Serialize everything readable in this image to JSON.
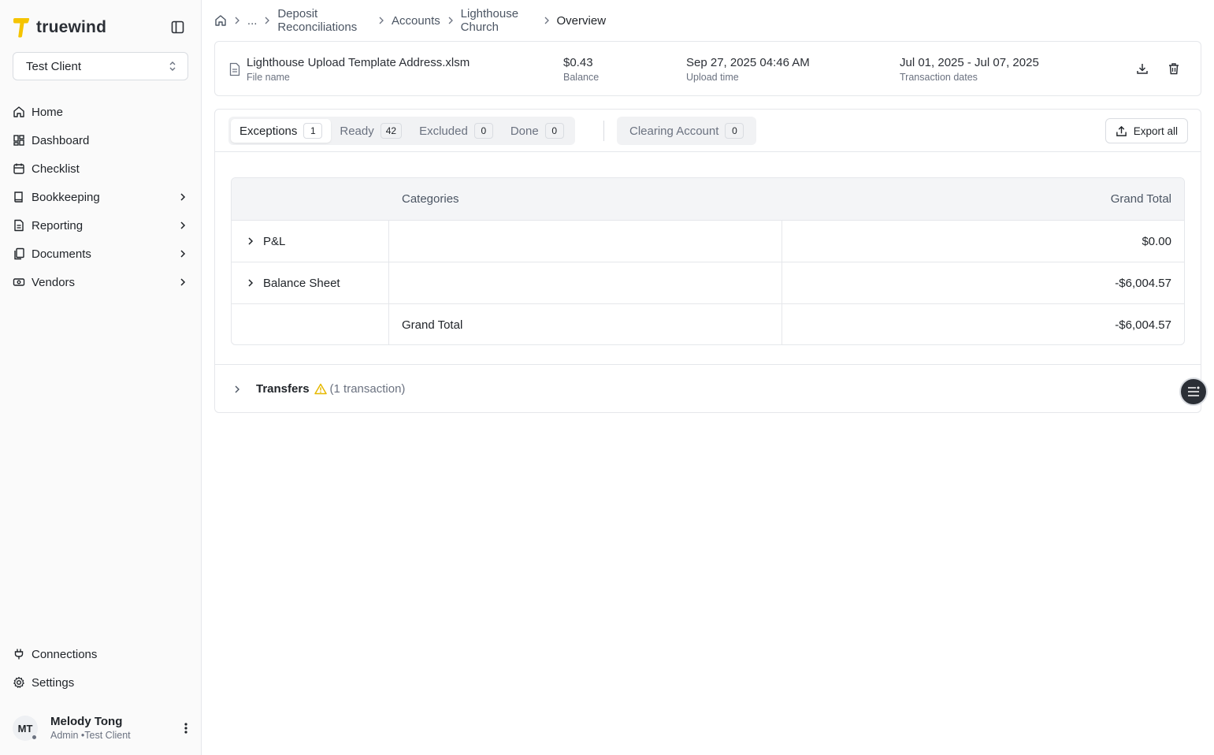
{
  "brand": {
    "name": "truewind",
    "accent": "#f5c400"
  },
  "client_select": {
    "value": "Test Client"
  },
  "nav": {
    "items": [
      {
        "label": "Home",
        "icon": "home-icon"
      },
      {
        "label": "Dashboard",
        "icon": "dashboard-icon"
      },
      {
        "label": "Checklist",
        "icon": "calendar-icon"
      },
      {
        "label": "Bookkeeping",
        "icon": "book-icon",
        "expandable": true
      },
      {
        "label": "Reporting",
        "icon": "report-icon",
        "expandable": true
      },
      {
        "label": "Documents",
        "icon": "documents-icon",
        "expandable": true
      },
      {
        "label": "Vendors",
        "icon": "vendor-icon",
        "expandable": true
      }
    ],
    "bottom": [
      {
        "label": "Connections",
        "icon": "plug-icon"
      },
      {
        "label": "Settings",
        "icon": "gear-icon"
      }
    ]
  },
  "user": {
    "initials": "MT",
    "name": "Melody Tong",
    "role": "Admin •Test Client"
  },
  "breadcrumb": {
    "ellipsis": "...",
    "items": [
      "Deposit Reconciliations",
      "Accounts",
      "Lighthouse Church"
    ],
    "current": "Overview"
  },
  "file": {
    "name": "Lighthouse Upload Template Address.xlsm",
    "name_label": "File name",
    "balance": "$0.43",
    "balance_label": "Balance",
    "upload_time": "Sep 27, 2025 04:46 AM",
    "upload_label": "Upload time",
    "dates": "Jul 01, 2025 - Jul 07, 2025",
    "dates_label": "Transaction dates"
  },
  "tabs": [
    {
      "label": "Exceptions",
      "count": "1",
      "active": true
    },
    {
      "label": "Ready",
      "count": "42"
    },
    {
      "label": "Excluded",
      "count": "0"
    },
    {
      "label": "Done",
      "count": "0"
    }
  ],
  "clearing_tab": {
    "label": "Clearing Account",
    "count": "0"
  },
  "export_label": "Export all",
  "table": {
    "headers": {
      "categories": "Categories",
      "total": "Grand Total"
    },
    "rows": [
      {
        "name": "P&L",
        "total": "$0.00"
      },
      {
        "name": "Balance Sheet",
        "total": "-$6,004.57"
      }
    ],
    "footer": {
      "label": "Grand Total",
      "total": "-$6,004.57"
    }
  },
  "transfers": {
    "title": "Transfers",
    "count": "(1 transaction)",
    "warning_color": "#e6b800"
  }
}
